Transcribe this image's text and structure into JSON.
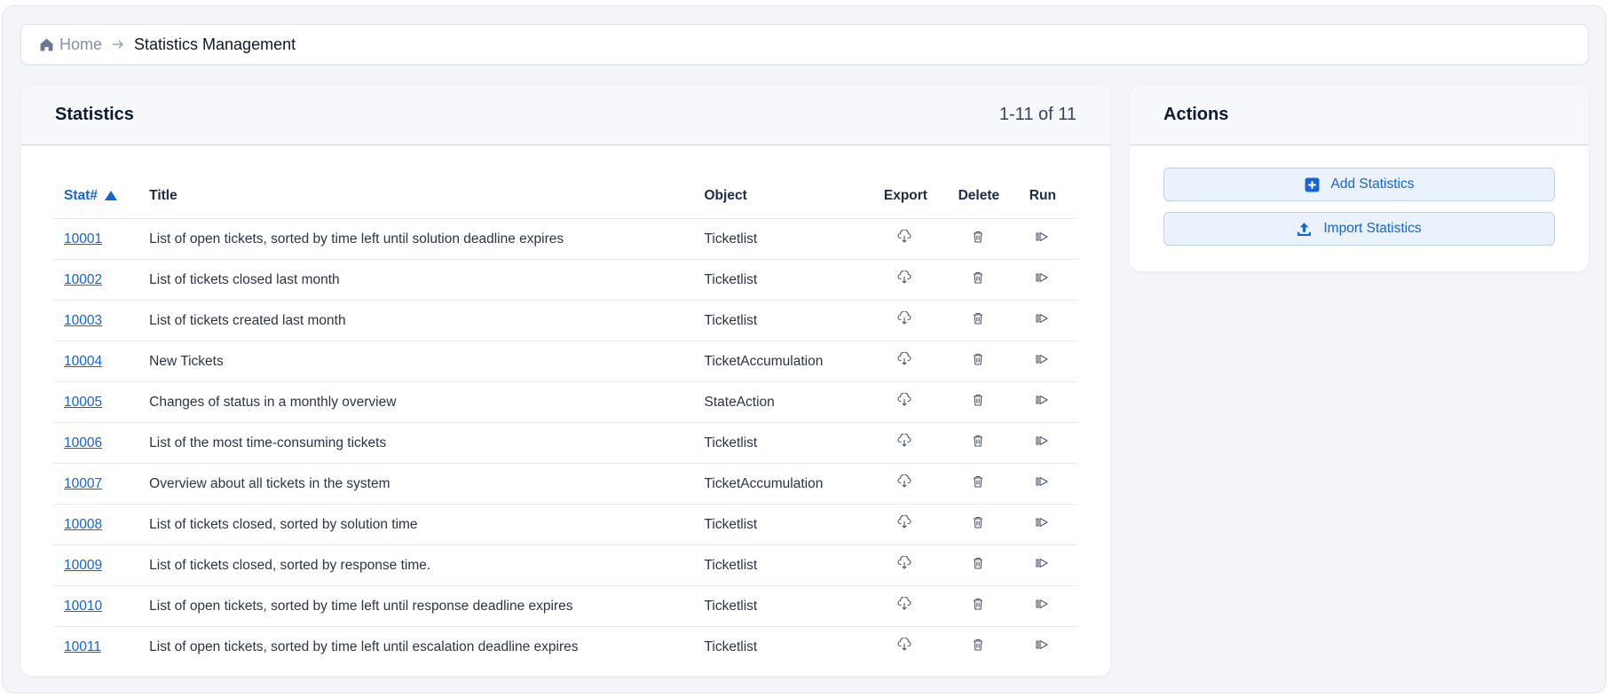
{
  "breadcrumb": {
    "home": "Home",
    "current": "Statistics Management"
  },
  "statistics": {
    "title": "Statistics",
    "count": "1-11 of 11",
    "columns": {
      "stat": "Stat#",
      "title": "Title",
      "object": "Object",
      "export": "Export",
      "delete": "Delete",
      "run": "Run"
    },
    "rows": [
      {
        "num": "10001",
        "title": "List of open tickets, sorted by time left until solution deadline expires",
        "object": "Ticketlist"
      },
      {
        "num": "10002",
        "title": "List of tickets closed last month",
        "object": "Ticketlist"
      },
      {
        "num": "10003",
        "title": "List of tickets created last month",
        "object": "Ticketlist"
      },
      {
        "num": "10004",
        "title": "New Tickets",
        "object": "TicketAccumulation"
      },
      {
        "num": "10005",
        "title": "Changes of status in a monthly overview",
        "object": "StateAction"
      },
      {
        "num": "10006",
        "title": "List of the most time-consuming tickets",
        "object": "Ticketlist"
      },
      {
        "num": "10007",
        "title": "Overview about all tickets in the system",
        "object": "TicketAccumulation"
      },
      {
        "num": "10008",
        "title": "List of tickets closed, sorted by solution time",
        "object": "Ticketlist"
      },
      {
        "num": "10009",
        "title": "List of tickets closed, sorted by response time.",
        "object": "Ticketlist"
      },
      {
        "num": "10010",
        "title": "List of open tickets, sorted by time left until response deadline expires",
        "object": "Ticketlist"
      },
      {
        "num": "10011",
        "title": "List of open tickets, sorted by time left until escalation deadline expires",
        "object": "Ticketlist"
      }
    ]
  },
  "actions": {
    "title": "Actions",
    "add_label": "Add Statistics",
    "import_label": "Import Statistics"
  },
  "colors": {
    "accent": "#1565d8",
    "button_bg": "#e9f2fd",
    "page_bg": "#f4f5f8"
  },
  "icons": {
    "home": "home-icon",
    "separator": "chevron-right-icon",
    "export": "cloud-download-icon",
    "delete": "trash-icon",
    "run": "run-icon",
    "add": "plus-square-icon",
    "import": "upload-icon"
  }
}
